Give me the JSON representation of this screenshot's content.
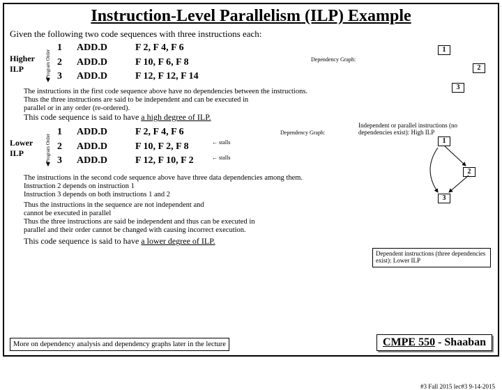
{
  "title": "Instruction-Level Parallelism (ILP) Example",
  "given": "Given the following two code sequences with three instructions each:",
  "porder_label": "Program Order",
  "higher": {
    "label": "Higher ILP",
    "r1": {
      "n": "1",
      "op": "ADD.D",
      "args": "F 2, F 4, F 6"
    },
    "r2": {
      "n": "2",
      "op": "ADD.D",
      "args": "F 10, F 6, F 8"
    },
    "r3": {
      "n": "3",
      "op": "ADD.D",
      "args": "F 12, F 12, F 14"
    },
    "dep_title": "Dependency Graph:",
    "node1": "1",
    "node2": "2",
    "node3": "3"
  },
  "expl1_l1": "The instructions in the first code sequence above have no dependencies between the instructions.",
  "expl1_l2": "Thus the three instructions are said to be independent and can be executed in",
  "expl1_l3": "parallel or in any order (re-ordered).",
  "expl1_l4": "This code sequence is said to have a high degree of ILP.",
  "side1": "Independent or parallel instructions (no dependencies exist): High ILP",
  "lower": {
    "label": "Lower ILP",
    "r1": {
      "n": "1",
      "op": "ADD.D",
      "args": "F 2, F 4, F 6"
    },
    "r2": {
      "n": "2",
      "op": "ADD.D",
      "args": "F 10, F 2, F 8"
    },
    "r3": {
      "n": "3",
      "op": "ADD.D",
      "args": "F 12, F 10, F 2"
    },
    "dep_title": "Dependency Graph:",
    "node1": "1",
    "node2": "2",
    "node3": "3",
    "stall": "stalls"
  },
  "expl2_l1": "The instructions in the second code sequence above have three data dependencies among them.",
  "expl2_l2": "Instruction 2 depends on instruction 1",
  "expl2_l3": "Instruction 3 depends on both instructions 1 and 2",
  "expl2_l4": "Thus the instructions in the sequence are not independent and",
  "expl2_l5": "cannot be executed in parallel",
  "expl2_l6": "Thus the three instructions are said be independent and thus can be executed in",
  "expl2_l7": "parallel and their order cannot be changed with causing incorrect execution.",
  "expl2_l8": "This code sequence is said to have a lower degree of ILP.",
  "caption2": "Dependent instructions (three dependencies exist): Lower ILP",
  "more": "More on dependency analysis and dependency graphs later in the lecture",
  "footer": {
    "course": "CMPE 550",
    "author": "Shaaban"
  },
  "lec": "#3 Fall 2015 lec#3 9-14-2015"
}
